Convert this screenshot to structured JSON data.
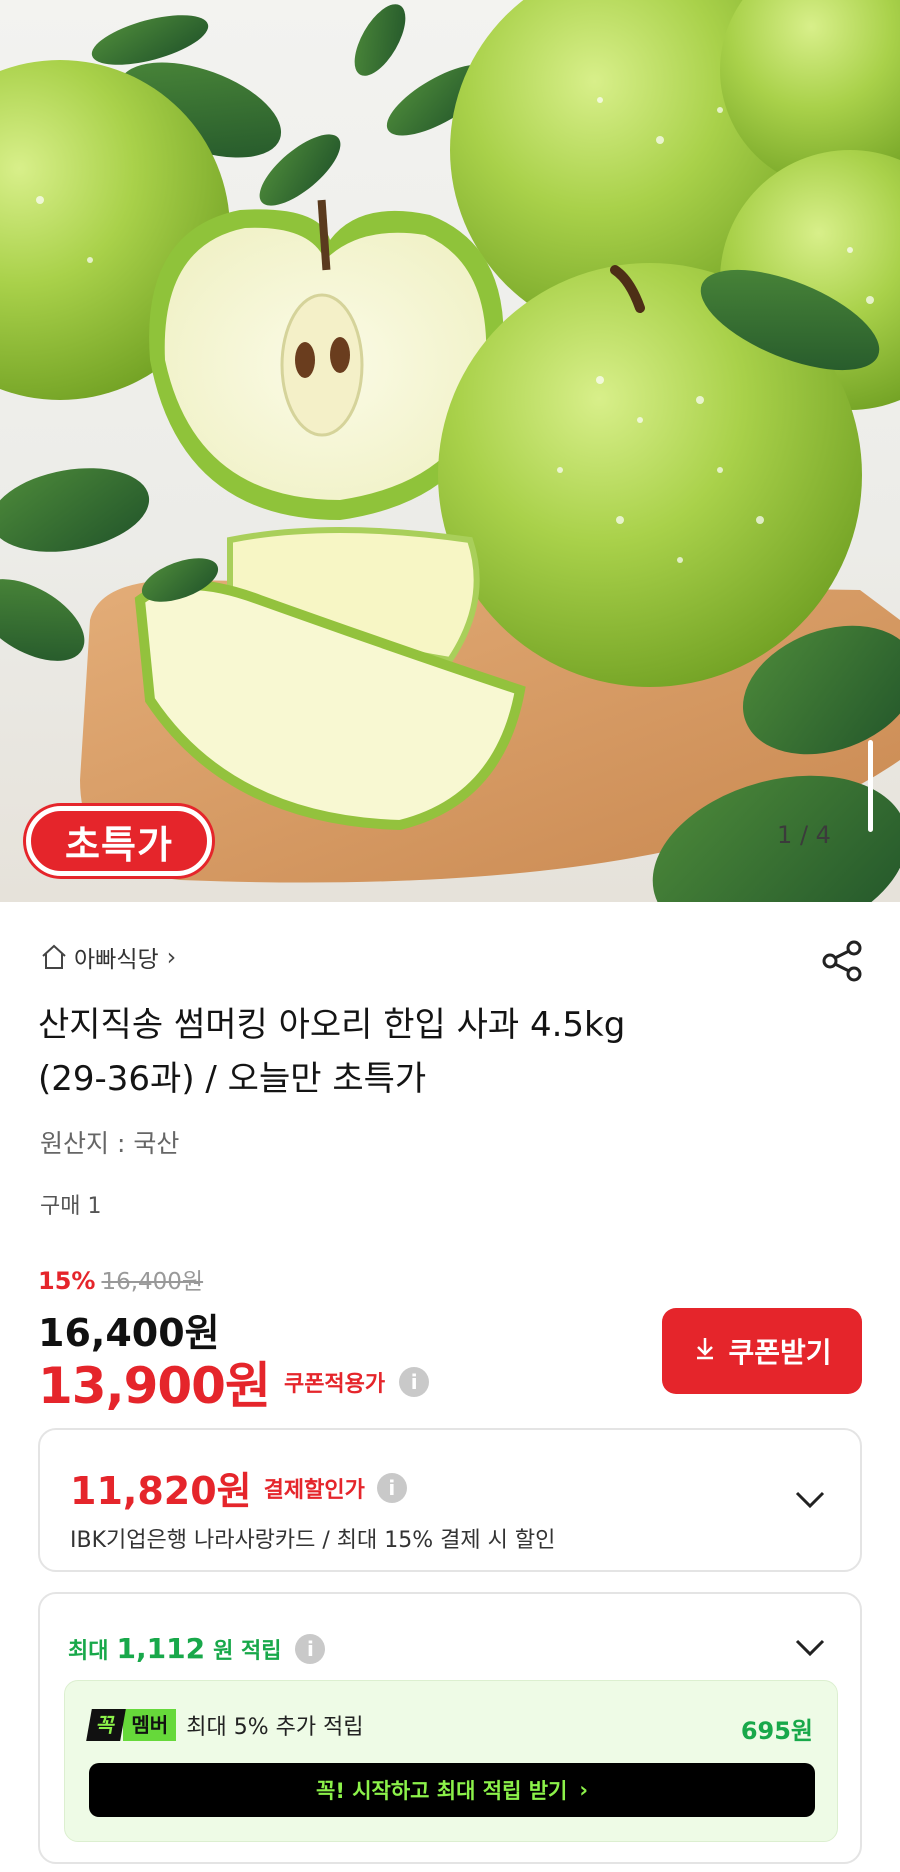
{
  "hero": {
    "badge": "초특가",
    "page_indicator": "1 / 4"
  },
  "store": {
    "name": "아빠식당",
    "chevron": "›"
  },
  "product": {
    "title_line1": "산지직송 썸머킹 아오리 한입 사과 4.5kg",
    "title_line2": "(29-36과) / 오늘만 초특가",
    "origin": "원산지 : 국산",
    "purchase_count": "구매 1"
  },
  "price": {
    "discount_rate": "15%",
    "original_price": "16,400원",
    "sale_price": "16,400원",
    "coupon_price": "13,900원",
    "coupon_label": "쿠폰적용가"
  },
  "coupon_button": {
    "label": "쿠폰받기"
  },
  "payment_discount": {
    "price": "11,820원",
    "label": "결제할인가",
    "description": "IBK기업은행 나라사랑카드 / 최대 15% 결제 시 할인"
  },
  "points": {
    "prefix": "최대",
    "amount": "1,112",
    "suffix": "원 적립"
  },
  "member": {
    "logo_k": "꼭",
    "logo_m": "멤버",
    "text": "최대 5% 추가 적립",
    "point": "695원",
    "button_label": "꼭! 시작하고 최대 적립 받기",
    "button_arrow": "›"
  },
  "colors": {
    "accent_red": "#e5252b",
    "point_green": "#18a84a",
    "member_black": "#000000",
    "member_lime": "#8cf24a"
  },
  "icons": [
    "home-icon",
    "share-icon",
    "info-icon",
    "download-icon",
    "chevron-down-icon"
  ]
}
